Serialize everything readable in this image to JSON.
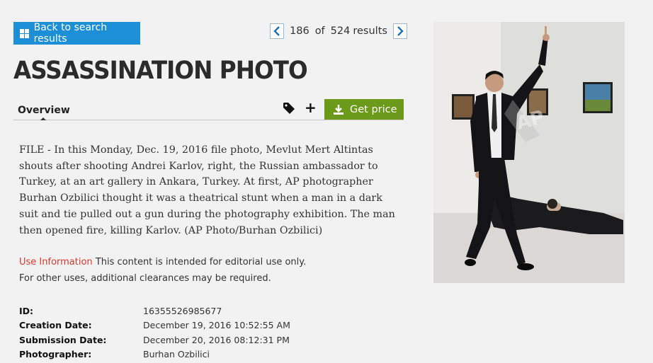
{
  "nav": {
    "back_label": "Back to search results",
    "current": "186",
    "of_label": "of",
    "total": "524",
    "results_label": "results"
  },
  "title": "ASSASSINATION PHOTO",
  "tabs": {
    "overview_label": "Overview"
  },
  "actions": {
    "get_price_label": "Get price"
  },
  "description": "FILE - In this Monday, Dec. 19, 2016 file photo, Mevlut Mert Altintas shouts after shooting Andrei Karlov, right, the Russian ambassador to Turkey, at an art gallery in Ankara, Turkey. At first, AP photographer Burhan Ozbilici thought it was a theatrical stunt when a man in a dark suit and tie pulled out a gun during the photography exhibition. The man then opened fire, killing Karlov. (AP Photo/Burhan Ozbilici)",
  "use_info": {
    "label": "Use Information",
    "line1": "This content is intended for editorial use only.",
    "line2": "For other uses, additional clearances may be required."
  },
  "metadata": [
    {
      "key": "ID:",
      "value": "16355526985677"
    },
    {
      "key": "Creation Date:",
      "value": "December 19, 2016 10:52:55 AM"
    },
    {
      "key": "Submission Date:",
      "value": "December 20, 2016 08:12:31 PM"
    },
    {
      "key": "Photographer:",
      "value": "Burhan Ozbilici"
    }
  ],
  "colors": {
    "back_button": "#1c8fd6",
    "price_button": "#6b9a1b",
    "use_info_label": "#d63a2c"
  },
  "icons": [
    "grid-icon",
    "chevron-left-icon",
    "chevron-right-icon",
    "tag-icon",
    "plus-icon",
    "download-icon"
  ]
}
